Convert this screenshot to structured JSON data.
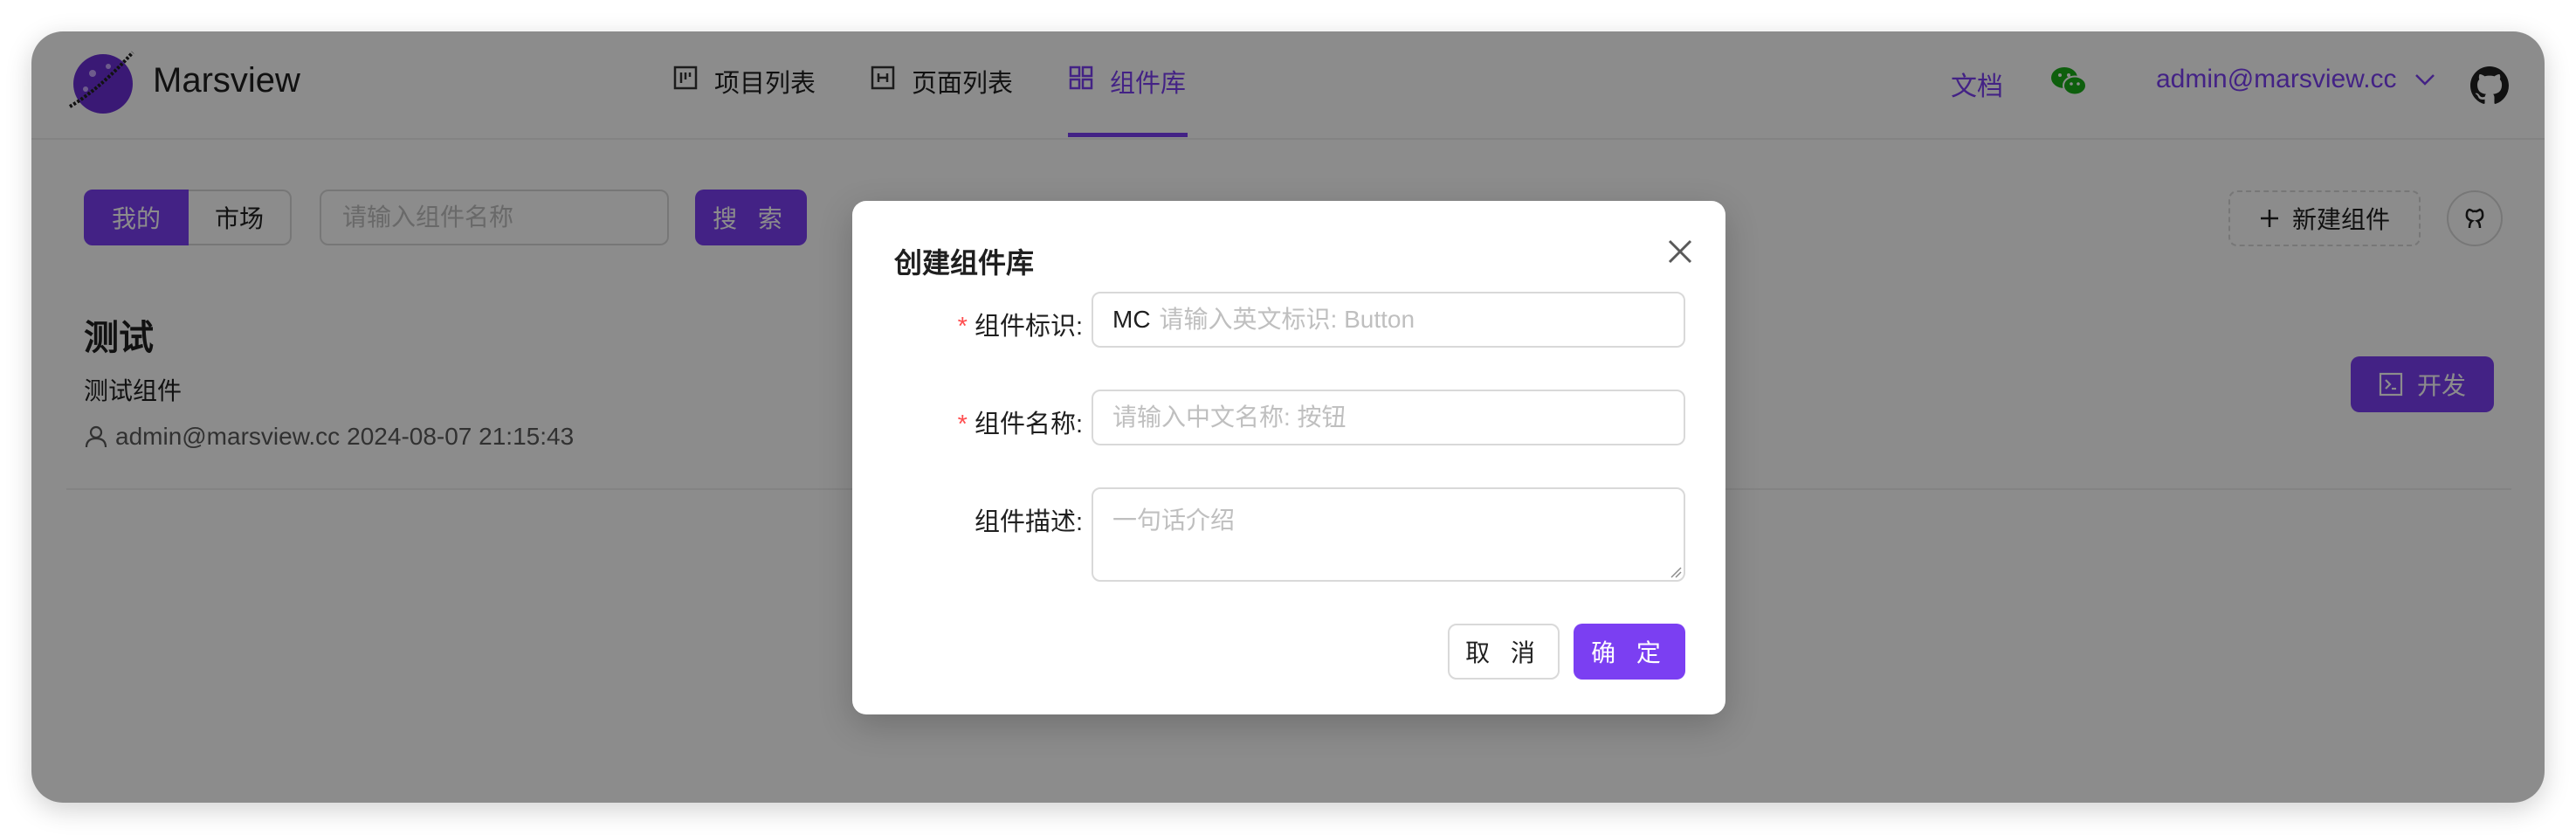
{
  "header": {
    "brand": "Marsview",
    "nav": [
      {
        "label": "项目列表",
        "icon": "project-board-icon"
      },
      {
        "label": "页面列表",
        "icon": "page-icon"
      },
      {
        "label": "组件库",
        "icon": "grid-icon",
        "active": true
      }
    ],
    "docs_label": "文档",
    "user_email": "admin@marsview.cc"
  },
  "toolbar": {
    "tab_mine": "我的",
    "tab_market": "市场",
    "search_placeholder": "请输入组件名称",
    "search_label": "搜 索",
    "new_component_label": "新建组件"
  },
  "card": {
    "title": "测试",
    "description": "测试组件",
    "author": "admin@marsview.cc",
    "date": "2024-08-07 21:15:43",
    "dev_label": "开发"
  },
  "modal": {
    "title": "创建组件库",
    "fields": {
      "identifier_label": "组件标识:",
      "identifier_prefix": "MC",
      "identifier_placeholder": "请输入英文标识: Button",
      "name_label": "组件名称:",
      "name_placeholder": "请输入中文名称: 按钮",
      "desc_label": "组件描述:",
      "desc_placeholder": "一句话介绍"
    },
    "cancel_label": "取 消",
    "ok_label": "确 定"
  },
  "colors": {
    "accent": "#7b3ff2",
    "required": "#ff4d4f",
    "wechat": "#1aad19"
  }
}
